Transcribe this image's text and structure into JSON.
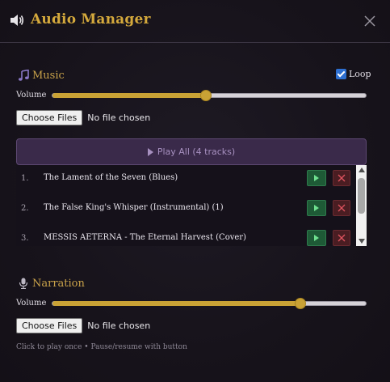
{
  "window": {
    "title": "Audio Manager",
    "close_label": "×"
  },
  "music": {
    "heading": "Music",
    "loop_label": "Loop",
    "loop_checked": true,
    "volume_label": "Volume",
    "volume_value": 0.49,
    "choose_files_label": "Choose Files",
    "file_status": "No file chosen",
    "play_all_label": "Play All (4 tracks)",
    "tracks": [
      {
        "num": "1.",
        "name": "The Lament of the Seven (Blues)"
      },
      {
        "num": "2.",
        "name": "The False King's Whisper (Instrumental) (1)"
      },
      {
        "num": "3.",
        "name": "MESSIS AETERNA - The Eternal Harvest (Cover)"
      }
    ]
  },
  "narration": {
    "heading": "Narration",
    "volume_label": "Volume",
    "volume_value": 0.79,
    "choose_files_label": "Choose Files",
    "file_status": "No file chosen",
    "hint": "Click to play once • Pause/resume with button"
  },
  "colors": {
    "accent_gold": "#d4a93c",
    "play_green": "#1e5a36",
    "delete_red": "#4a1d22",
    "play_all_bg": "#3a2a4a"
  },
  "icons": {
    "header": "speaker-volume-icon",
    "music": "music-note-icon",
    "narration": "microphone-icon",
    "close": "close-icon",
    "play": "play-icon",
    "delete": "x-icon"
  }
}
